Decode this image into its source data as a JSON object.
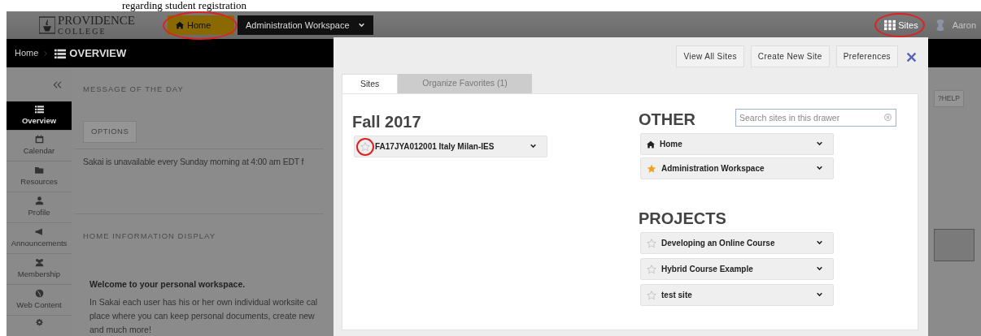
{
  "caption": "regarding student registration",
  "header": {
    "logo": {
      "line_1": "PROVIDENCE",
      "line_2": "COLLEGE"
    },
    "site_tabs": [
      {
        "label": "Home",
        "kind": "home",
        "selected": true
      },
      {
        "label": "Administration Workspace",
        "kind": "dropdown",
        "selected": false
      }
    ],
    "sites_button": "Sites",
    "user_name": "Aaron"
  },
  "breadcrumb": {
    "home": "Home",
    "current": "OVERVIEW"
  },
  "sidebar": {
    "items": [
      {
        "label": "Overview",
        "selected": true
      },
      {
        "label": "Calendar",
        "selected": false
      },
      {
        "label": "Resources",
        "selected": false
      },
      {
        "label": "Profile",
        "selected": false
      },
      {
        "label": "Announcements",
        "selected": false
      },
      {
        "label": "Membership",
        "selected": false
      },
      {
        "label": "Web Content",
        "selected": false
      },
      {
        "selected": false
      }
    ]
  },
  "content": {
    "motd_title": "MESSAGE OF THE DAY",
    "options_button": "OPTIONS",
    "motd_text": "Sakai is unavailable every Sunday morning at 4:00 am EDT f",
    "info_title": "HOME INFORMATION DISPLAY",
    "welcome": "Welcome to your personal workspace.",
    "paragraph_lines": [
      "In Sakai each user has his or her own individual worksite cal",
      "place where you can keep personal documents, create new",
      "and much more!"
    ],
    "help_button": "?HELP"
  },
  "drawer": {
    "buttons": [
      "View All Sites",
      "Create New Site",
      "Preferences"
    ],
    "tabs": [
      {
        "label": "Sites",
        "selected": true
      },
      {
        "label": "Organize Favorites (1)",
        "selected": false
      }
    ],
    "search": {
      "placeholder": "Search sites in this drawer"
    },
    "terms": [
      {
        "title": "Fall 2017",
        "sites": [
          {
            "name": "FA17JYA012001 Italy Milan-IES",
            "kind": "star",
            "favorite": false
          }
        ]
      }
    ],
    "other": {
      "title": "OTHER",
      "sites": [
        {
          "name": "Home",
          "kind": "home"
        },
        {
          "name": "Administration Workspace",
          "kind": "star",
          "favorite": true
        }
      ]
    },
    "projects": {
      "title": "PROJECTS",
      "sites": [
        {
          "name": "Developing an Online Course",
          "kind": "star",
          "favorite": false
        },
        {
          "name": "Hybrid Course Example",
          "kind": "star",
          "favorite": false
        },
        {
          "name": "test site",
          "kind": "star",
          "favorite": false
        }
      ]
    }
  }
}
